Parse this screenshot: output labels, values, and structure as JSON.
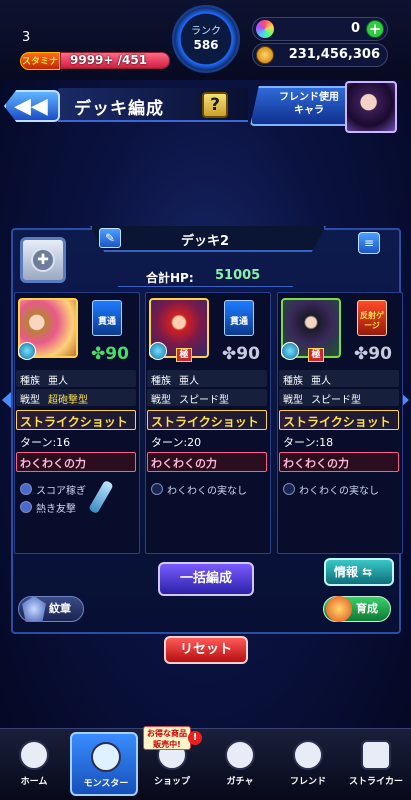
{
  "status": {
    "level": "3",
    "stamina_label": "スタミナ",
    "stamina_text": "9999+ /451",
    "stamina_fraction": 1.0,
    "rank_label": "ランク",
    "rank_value": "586",
    "gems": "0",
    "coins": "231,456,306",
    "plus_label": "+"
  },
  "header": {
    "back_label": "◀◀",
    "title": "デッキ編成",
    "help_label": "?",
    "friend_button_line1": "フレンド使用",
    "friend_button_line2": "キャラ"
  },
  "deck": {
    "name": "デッキ2",
    "edit_icon": "✎",
    "list_icon": "≡",
    "lock_icon": "✚",
    "hp_label": "合計HP:",
    "hp_value": "51005",
    "bulk_button": "一括編成",
    "info_button": "情報 ⇆",
    "crest_button": "紋章",
    "grow_button": "育成",
    "reset_button": "リセット"
  },
  "cards": [
    {
      "type_badge": "貫通",
      "luck": "90",
      "race_label": "種族",
      "race": "亜人",
      "style_label": "戦型",
      "style": "超砲撃型",
      "strike_shot": "ストライクショット",
      "turn": "ターン:16",
      "ability": "わくわくの力",
      "gauges": [
        "スコア稼ぎ",
        "熱き友撃"
      ],
      "badge": ""
    },
    {
      "type_badge": "貫通",
      "luck": "90",
      "race_label": "種族",
      "race": "亜人",
      "style_label": "戦型",
      "style": "スピード型",
      "strike_shot": "ストライクショット",
      "turn": "ターン:20",
      "ability": "わくわくの力",
      "gauges": [
        "わくわくの実なし"
      ],
      "badge": "極"
    },
    {
      "type_badge": "反射ゲージ",
      "luck": "90",
      "race_label": "種族",
      "race": "亜人",
      "style_label": "戦型",
      "style": "スピード型",
      "strike_shot": "ストライクショット",
      "turn": "ターン:18",
      "ability": "わくわくの力",
      "gauges": [
        "わくわくの実なし"
      ],
      "badge": "極"
    }
  ],
  "nav": [
    {
      "label": "ホーム",
      "icon": "home-icon"
    },
    {
      "label": "モンスター",
      "icon": "monster-icon"
    },
    {
      "label": "ショップ",
      "icon": "shop-icon"
    },
    {
      "label": "ガチャ",
      "icon": "gacha-icon"
    },
    {
      "label": "フレンド",
      "icon": "friend-icon"
    },
    {
      "label": "ストライカー",
      "icon": "striker-icon"
    }
  ],
  "sale_badge_line1": "お得な商品",
  "sale_badge_line2": "販売中!",
  "sale_dot": "!",
  "colors": {
    "accent": "#2a4ea6",
    "strike_shot": "#ffe14a",
    "hp": "#8af0a8",
    "reset": "#d81a1a"
  }
}
